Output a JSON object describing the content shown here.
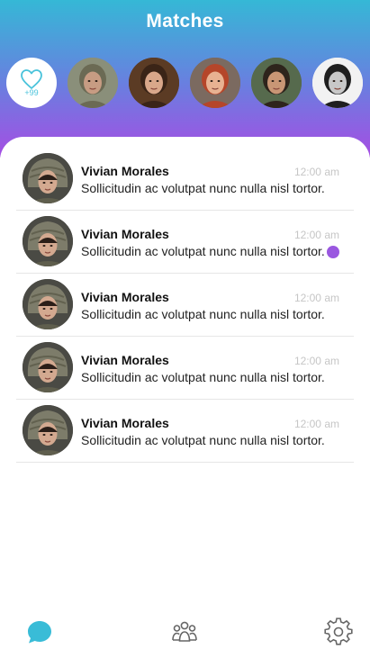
{
  "header": {
    "title": "Matches"
  },
  "matches": {
    "likes_count": "+99",
    "avatars": [
      {
        "name": "match-avatar-1",
        "skin": "#c79c83",
        "hair": "#6b6a54",
        "bg": "#8a8f7a"
      },
      {
        "name": "match-avatar-2",
        "skin": "#d9a78a",
        "hair": "#3a2417",
        "bg": "#5b3b24"
      },
      {
        "name": "match-avatar-3",
        "skin": "#e8b292",
        "hair": "#b5462a",
        "bg": "#7b6a60"
      },
      {
        "name": "match-avatar-4",
        "skin": "#c99675",
        "hair": "#2e241c",
        "bg": "#566a4d"
      },
      {
        "name": "match-avatar-5",
        "skin": "#c8c8c8",
        "hair": "#1f1f1f",
        "bg": "#f2f2f2"
      }
    ]
  },
  "conversations": [
    {
      "name": "Vivian Morales",
      "time": "12:00 am",
      "message": "Sollicitudin ac volutpat nunc nulla nisl tortor.",
      "unread": false
    },
    {
      "name": "Vivian Morales",
      "time": "12:00 am",
      "message": "Sollicitudin ac volutpat nunc nulla nisl tortor.",
      "unread": true
    },
    {
      "name": "Vivian Morales",
      "time": "12:00 am",
      "message": "Sollicitudin ac volutpat nunc nulla nisl tortor.",
      "unread": false
    },
    {
      "name": "Vivian Morales",
      "time": "12:00 am",
      "message": "Sollicitudin ac volutpat nunc nulla nisl tortor.",
      "unread": false
    },
    {
      "name": "Vivian Morales",
      "time": "12:00 am",
      "message": "Sollicitudin ac volutpat nunc nulla nisl tortor.",
      "unread": false
    }
  ],
  "tabbar": {
    "items": [
      {
        "icon": "chat-bubble-icon",
        "active": true,
        "color": "#39bcd7"
      },
      {
        "icon": "people-group-icon",
        "active": false,
        "color": "#666666"
      },
      {
        "icon": "gear-icon",
        "active": false,
        "color": "#666666"
      }
    ]
  },
  "colors": {
    "accent": "#39bcd7",
    "unread": "#9a57e0"
  }
}
